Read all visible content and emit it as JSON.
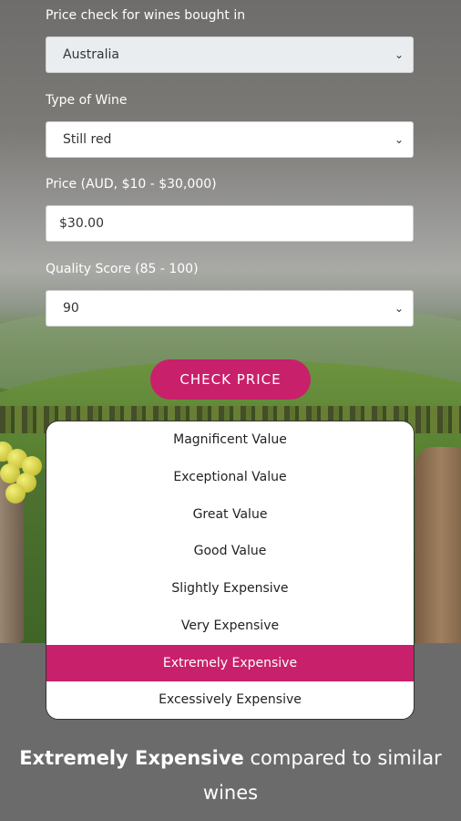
{
  "form": {
    "country_label": "Price check for wines bought in",
    "country_value": "Australia",
    "wine_type_label": "Type of Wine",
    "wine_type_value": "Still red",
    "price_label": "Price (AUD, $10 - $30,000)",
    "price_value": "$30.00",
    "quality_label": "Quality Score (85 - 100)",
    "quality_value": "90",
    "check_button": "CHECK PRICE"
  },
  "scale": {
    "items": [
      "Magnificent Value",
      "Exceptional Value",
      "Great Value",
      "Good Value",
      "Slightly Expensive",
      "Very Expensive",
      "Extremely Expensive",
      "Excessively Expensive"
    ],
    "active_index": 6
  },
  "result": {
    "bold": "Extremely Expensive",
    "rest": " compared to similar wines"
  },
  "colors": {
    "accent": "#c8206b"
  }
}
